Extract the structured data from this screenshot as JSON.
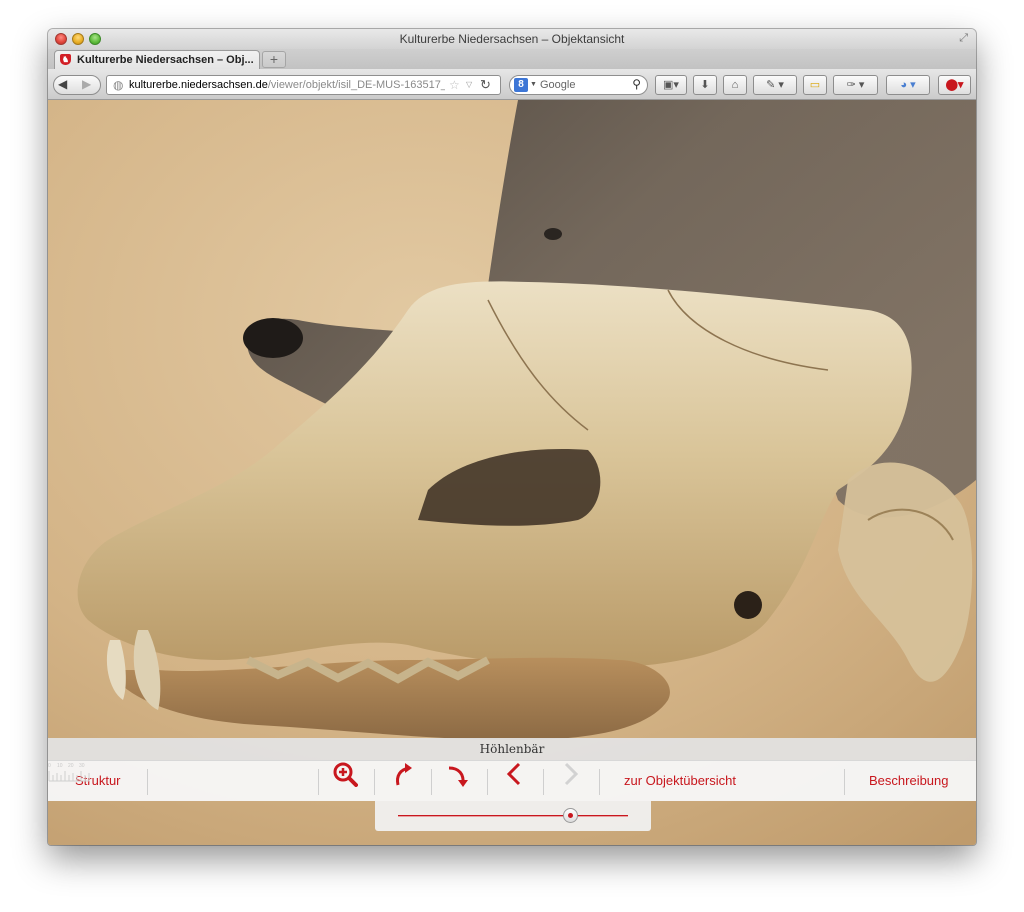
{
  "window": {
    "title": "Kulturerbe Niedersachsen – Objektansicht"
  },
  "tab": {
    "label": "Kulturerbe Niedersachsen – Obj...",
    "new_tab_label": "+"
  },
  "navbar": {
    "url_host": "kulturerbe.niedersachsen.de",
    "url_path": "/viewer/objekt/isil_DE-MUS-163517_",
    "search_engine_letter": "8",
    "search_placeholder": "Google"
  },
  "viewer": {
    "object_title": "Höhlenbär",
    "structure_label": "Struktur",
    "overview_label": "zur Objektübersicht",
    "description_label": "Beschreibung",
    "zoom_level": 0.75,
    "ruler_ticks": [
      "0",
      "10",
      "20",
      "30"
    ]
  },
  "colors": {
    "accent": "#c8171e",
    "disabled": "#d2d2d2"
  },
  "icons": {
    "zoom": "zoom-in-icon",
    "rotate_left": "rotate-left-icon",
    "rotate_right": "rotate-right-icon",
    "previous": "chevron-left-icon",
    "next": "chevron-right-icon"
  }
}
